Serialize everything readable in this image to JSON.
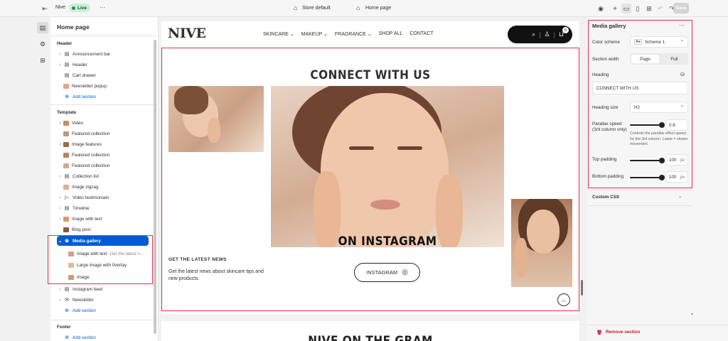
{
  "topbar": {
    "store_name": "Nive",
    "live_badge": "Live",
    "more": "···",
    "store_select": "Store default",
    "page_select": "Home page",
    "save_label": "Save"
  },
  "left_panel": {
    "title": "Home page",
    "header_title": "Header",
    "header_items": [
      "Announcement bar",
      "Header",
      "Cart drawer",
      "Newsletter popup"
    ],
    "add_section": "Add section",
    "template_title": "Template",
    "template_items": [
      "Video",
      "Featured collection",
      "Image features",
      "Featured collection",
      "Featured collection",
      "Collection list",
      "Image zigzag",
      "Video testimonials",
      "Timeline",
      "Image with text",
      "Blog post"
    ],
    "selected_item": "Media gallery",
    "child_items": [
      {
        "label": "Image with text",
        "sub": " - Get the latest n..."
      },
      {
        "label": "Large image with 0verlay",
        "sub": ""
      },
      {
        "label": "Image",
        "sub": ""
      }
    ],
    "after_items": [
      "Instagram feed",
      "Newsletter"
    ],
    "add_section_2": "Add section",
    "footer_title": "Footer",
    "add_section_3": "Add section"
  },
  "preview": {
    "logo": "NIVE",
    "nav": [
      "SKINCARE",
      "MAKEUP",
      "FRAGRANCE",
      "SHOP ALL",
      "CONTACT"
    ],
    "cart_count": "0",
    "heading": "CONNECT WITH US",
    "overlay_heading": "ON INSTAGRAM",
    "latest_title": "GET THE LATEST NEWS",
    "latest_text": "Get the latest news about skincare tips and new products.",
    "instagram_button": "INSTAGRAM",
    "next_heading": "NIVE ON THE GRAM"
  },
  "right_panel": {
    "title": "Media gallery",
    "more": "···",
    "color_scheme_label": "Color scheme",
    "color_scheme_value": "Scheme 1",
    "color_scheme_swatch": "Aa",
    "section_width_label": "Section width",
    "width_options": [
      "Page",
      "Full"
    ],
    "heading_label": "Heading",
    "heading_value": "CONNECT WITH US",
    "heading_size_label": "Heading size",
    "heading_size_value": "H2",
    "parallax_label": "Parallax speed (3rd column only)",
    "parallax_value": "0.8",
    "parallax_help": "Controls the parallax effect speed for the 3rd column. Lower = slower movement.",
    "top_padding_label": "Top padding",
    "top_padding_value": "100",
    "bottom_padding_label": "Bottom padding",
    "bottom_padding_value": "100",
    "unit": "px",
    "custom_css": "Custom CSS",
    "remove_section": "Remove section"
  },
  "colors": {
    "accent": "#005bd3",
    "highlight": "#e0304f",
    "live": "#2e8b57"
  }
}
